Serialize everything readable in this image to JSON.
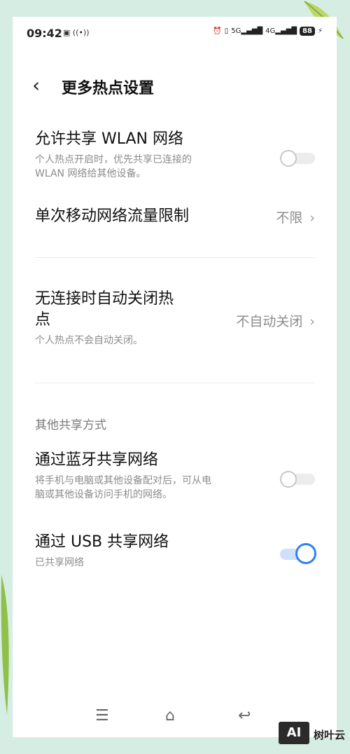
{
  "status_bar": {
    "time": "09:42",
    "left_icons": [
      "sim-icon",
      "hotspot-icon"
    ],
    "right_icons": [
      "alarm-icon",
      "vibrate-icon",
      "signal-5g-icon",
      "signal-4g-icon"
    ],
    "battery": "88"
  },
  "header": {
    "back_icon": "chevron-left-icon",
    "title": "更多热点设置"
  },
  "settings": {
    "allow_wlan": {
      "title": "允许共享 WLAN 网络",
      "desc_line1": "个人热点开启时，优先共享已连接的",
      "desc_line2": "WLAN 网络给其他设备。",
      "enabled": false
    },
    "data_limit": {
      "title": "单次移动网络流量限制",
      "value": "不限"
    },
    "auto_close": {
      "title_line1": "无连接时自动关闭热",
      "title_line2": "点",
      "desc": "个人热点不会自动关闭。",
      "value": "不自动关闭"
    },
    "other_section": "其他共享方式",
    "bluetooth": {
      "title": "通过蓝牙共享网络",
      "desc_line1": "将手机与电脑或其他设备配对后，可从电",
      "desc_line2": "脑或其他设备访问手机的网络。",
      "enabled": false
    },
    "usb": {
      "title": "通过 USB 共享网络",
      "desc": "已共享网络",
      "enabled": true
    }
  },
  "nav": {
    "menu_icon": "menu-icon",
    "home_icon": "home-icon",
    "back_icon": "back-icon"
  },
  "watermark": {
    "logo": "AI",
    "text": "树叶云"
  },
  "colors": {
    "accent": "#2f7ff0",
    "background": "#d6ede3"
  }
}
